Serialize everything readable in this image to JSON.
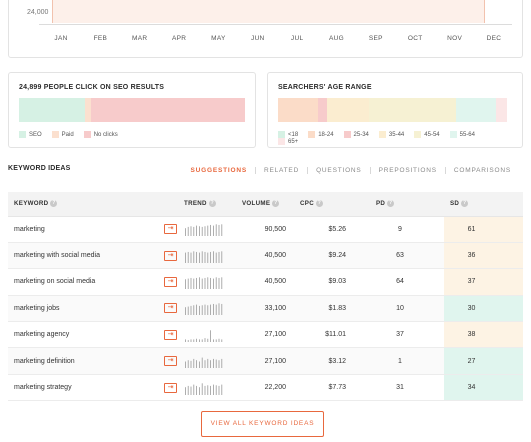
{
  "trend": {
    "y_tick": "24,000",
    "months": [
      "JAN",
      "FEB",
      "MAR",
      "APR",
      "MAY",
      "JUN",
      "JUL",
      "AUG",
      "SEP",
      "OCT",
      "NOV",
      "DEC"
    ]
  },
  "clicks_card": {
    "title": "24,899 PEOPLE CLICK ON SEO RESULTS",
    "segments": [
      {
        "label": "SEO",
        "color": "#d6f1e4",
        "share": 0.29
      },
      {
        "label": "Paid",
        "color": "#fbe0cf",
        "share": 0.03
      },
      {
        "label": "No clicks",
        "color": "#f7cbcb",
        "share": 0.68
      }
    ]
  },
  "age_card": {
    "title": "SEARCHERS' AGE RANGE",
    "segments": [
      {
        "label": "<18",
        "color": "#d6f1e4",
        "share": 0.0
      },
      {
        "label": "18-24",
        "color": "#fbdcc8",
        "share": 0.17
      },
      {
        "label": "25-34",
        "color": "#f7cbcb",
        "share": 0.04
      },
      {
        "label": "35-44",
        "color": "#fbedd0",
        "share": 0.18
      },
      {
        "label": "45-54",
        "color": "#f6f1d3",
        "share": 0.37
      },
      {
        "label": "55-64",
        "color": "#e0f5ee",
        "share": 0.17
      },
      {
        "label": "65+",
        "color": "#fbe6e6",
        "share": 0.05
      }
    ]
  },
  "keyword_ideas": {
    "title": "KEYWORD IDEAS",
    "tabs": [
      "SUGGESTIONS",
      "RELATED",
      "QUESTIONS",
      "PREPOSITIONS",
      "COMPARISONS"
    ],
    "active_tab": "SUGGESTIONS",
    "columns": {
      "keyword": "KEYWORD",
      "trend": "TREND",
      "volume": "VOLUME",
      "cpc": "CPC",
      "pd": "PD",
      "sd": "SD"
    },
    "rows": [
      {
        "keyword": "marketing",
        "volume": "90,500",
        "cpc": "$5.26",
        "pd": "9",
        "sd": "61",
        "sd_color": "#fdf3e4",
        "spark": [
          0.6,
          0.7,
          0.75,
          0.7,
          0.8,
          0.75,
          0.7,
          0.75,
          0.8,
          0.85,
          0.8,
          0.9,
          0.85,
          0.9
        ]
      },
      {
        "keyword": "marketing with social media",
        "volume": "40,500",
        "cpc": "$9.24",
        "pd": "63",
        "sd": "36",
        "sd_color": "#fdf3e4",
        "spark": [
          0.8,
          0.85,
          0.8,
          0.9,
          0.85,
          0.8,
          0.9,
          0.85,
          0.8,
          0.85,
          0.9,
          0.8,
          0.85,
          0.9
        ]
      },
      {
        "keyword": "marketing on social media",
        "volume": "40,500",
        "cpc": "$9.03",
        "pd": "64",
        "sd": "37",
        "sd_color": "#fdf3e4",
        "spark": [
          0.75,
          0.8,
          0.85,
          0.8,
          0.85,
          0.9,
          0.8,
          0.85,
          0.9,
          0.85,
          0.8,
          0.9,
          0.85,
          0.9
        ]
      },
      {
        "keyword": "marketing jobs",
        "volume": "33,100",
        "cpc": "$1.83",
        "pd": "10",
        "sd": "30",
        "sd_color": "#e0f5ee",
        "spark": [
          0.6,
          0.65,
          0.7,
          0.75,
          0.8,
          0.7,
          0.75,
          0.8,
          0.75,
          0.8,
          0.85,
          0.8,
          0.9,
          0.85
        ]
      },
      {
        "keyword": "marketing agency",
        "volume": "27,100",
        "cpc": "$11.01",
        "pd": "37",
        "sd": "38",
        "sd_color": "#fdf3e4",
        "spark": [
          0.2,
          0.15,
          0.2,
          0.2,
          0.25,
          0.2,
          0.2,
          0.3,
          0.25,
          0.9,
          0.2,
          0.2,
          0.25,
          0.2
        ]
      },
      {
        "keyword": "marketing definition",
        "volume": "27,100",
        "cpc": "$3.12",
        "pd": "1",
        "sd": "27",
        "sd_color": "#e0f5ee",
        "spark": [
          0.5,
          0.6,
          0.55,
          0.7,
          0.6,
          0.5,
          0.8,
          0.6,
          0.7,
          0.6,
          0.7,
          0.65,
          0.6,
          0.7
        ]
      },
      {
        "keyword": "marketing strategy",
        "volume": "22,200",
        "cpc": "$7.73",
        "pd": "31",
        "sd": "34",
        "sd_color": "#e0f5ee",
        "spark": [
          0.6,
          0.7,
          0.65,
          0.8,
          0.7,
          0.6,
          0.9,
          0.7,
          0.75,
          0.7,
          0.8,
          0.75,
          0.7,
          0.8
        ]
      }
    ]
  },
  "view_all_label": "VIEW ALL KEYWORD IDEAS",
  "colors": {
    "accent": "#e8683e",
    "sd_easy": "#e0f5ee",
    "sd_medium": "#fdf3e4"
  }
}
